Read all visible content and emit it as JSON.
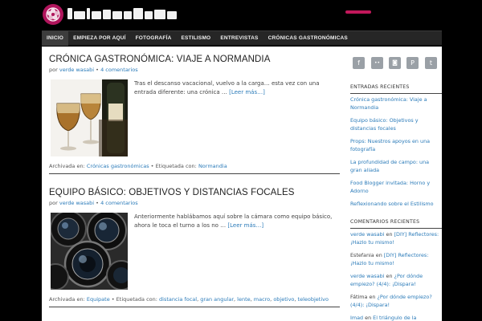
{
  "nav": {
    "items": [
      "INICIO",
      "EMPIEZA POR AQUÍ",
      "FOTOGRAFÍA",
      "ESTILISMO",
      "ENTREVISTAS",
      "CRÓNICAS GASTRONÓMICAS"
    ]
  },
  "posts": [
    {
      "title": "Crónica gastronómica: Viaje a Normandia",
      "by": "por",
      "author": "verde wasabi",
      "sep": "•",
      "comments": "4 comentarios",
      "excerpt": "Tras el descanso vacacional, vuelvo a la carga… esta vez con una entrada diferente: una crónica …",
      "more": "[Leer más…]",
      "filed_label": "Archivada en:",
      "category": "Crónicas gastronómicas",
      "tagged_label": "• Etiquetada con:",
      "tags": [
        "Normandia"
      ]
    },
    {
      "title": "Equipo básico: objetivos y distancias focales",
      "by": "por",
      "author": "verde wasabi",
      "sep": "•",
      "comments": "4 comentarios",
      "excerpt": "Anteriormente hablábamos aquí sobre la cámara como equipo básico, ahora le toca el turno a los no …",
      "more": "[Leer más…]",
      "filed_label": "Archivada en:",
      "category": "Equipate",
      "tagged_label": "• Etiquetada con:",
      "tags": [
        "distancia focal",
        "gran angular",
        "lente",
        "macro",
        "objetivo",
        "teleobjetivo"
      ]
    }
  ],
  "sidebar": {
    "social": [
      {
        "icon": "facebook-icon",
        "glyph": "f"
      },
      {
        "icon": "flickr-icon",
        "glyph": "••"
      },
      {
        "icon": "instagram-icon",
        "glyph": "◙"
      },
      {
        "icon": "pinterest-icon",
        "glyph": "P"
      },
      {
        "icon": "twitter-icon",
        "glyph": "t"
      }
    ],
    "recent_title": "Entradas recientes",
    "recent": [
      "Crónica gastronómica: Viaje a Normandia",
      "Equipo básico: Objetivos y distancias focales",
      "Props: Nuestros apoyos en una fotografía",
      "La profundidad de campo: una gran aliada",
      "Food Blogger invitada: Horno y Adorno",
      "Reflexionando sobre el Estilismo"
    ],
    "comments_title": "Comentarios recientes",
    "comments": [
      {
        "author": "verde wasabi",
        "on": "en",
        "post": "[DIY] Reflectores: ¡Hazlo tu mismo!"
      },
      {
        "author": "Estefania",
        "on": "en",
        "post": "[DIY] Reflectores: ¡Hazlo tu mismo!"
      },
      {
        "author": "verde wasabi",
        "on": "en",
        "post": "¿Por dónde empiezo? (4/4): ¡Dispara!"
      },
      {
        "author": "Fátima",
        "on": "en",
        "post": "¿Por dónde empiezo? (4/4): ¡Dispara!"
      },
      {
        "author": "Imad",
        "on": "en",
        "post": "El triángulo de la exposición (I): La apertura"
      }
    ]
  },
  "colors": {
    "brand": "#b0155c",
    "link": "#2b7bb9",
    "nav_bg": "#262626"
  }
}
